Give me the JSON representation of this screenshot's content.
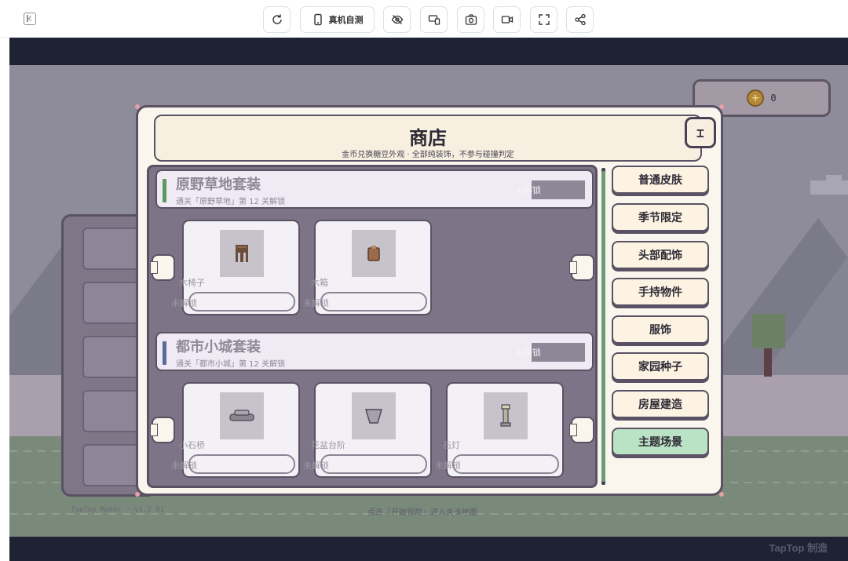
{
  "toolbar": {
    "device_test_label": "真机自测",
    "buttons": [
      "refresh-icon",
      "phone-icon",
      "eye-off-icon",
      "device-switch-icon",
      "camera-icon",
      "video-icon",
      "fullscreen-icon",
      "share-icon"
    ]
  },
  "game": {
    "coins": "0",
    "footer_version": "TapTop Maker · v1.2 01",
    "footer_hint": "点击「开始冒险」进入关卡地图",
    "watermark": "TapTop 制造"
  },
  "shop": {
    "title": "商店",
    "subtitle": "金币兑换糖豆外观 · 全部纯装饰，不参与碰撞判定",
    "close_label": "⌶",
    "sets": [
      {
        "name": "原野草地套装",
        "condition": "通关「原野草地」第 12 关解锁",
        "status": "未解锁",
        "bar_color": "#5c9a5e",
        "items": [
          {
            "name": "木椅子",
            "lock": "未解锁",
            "icon": "chair-icon"
          },
          {
            "name": "木箱",
            "lock": "未解锁",
            "icon": "box-icon"
          }
        ]
      },
      {
        "name": "都市小城套装",
        "condition": "通关「都市小城」第 12 关解锁",
        "status": "未解锁",
        "bar_color": "#5a6a9a",
        "items": [
          {
            "name": "小石桥",
            "lock": "未解锁",
            "icon": "bridge-icon"
          },
          {
            "name": "花盆台阶",
            "lock": "未解锁",
            "icon": "pot-icon"
          },
          {
            "name": "石灯",
            "lock": "未解锁",
            "icon": "lamp-icon"
          }
        ]
      }
    ],
    "categories": [
      "普通皮肤",
      "季节限定",
      "头部配饰",
      "手持物件",
      "服饰",
      "家园种子",
      "房屋建造",
      "主题场景"
    ],
    "active_category": "主题场景"
  }
}
